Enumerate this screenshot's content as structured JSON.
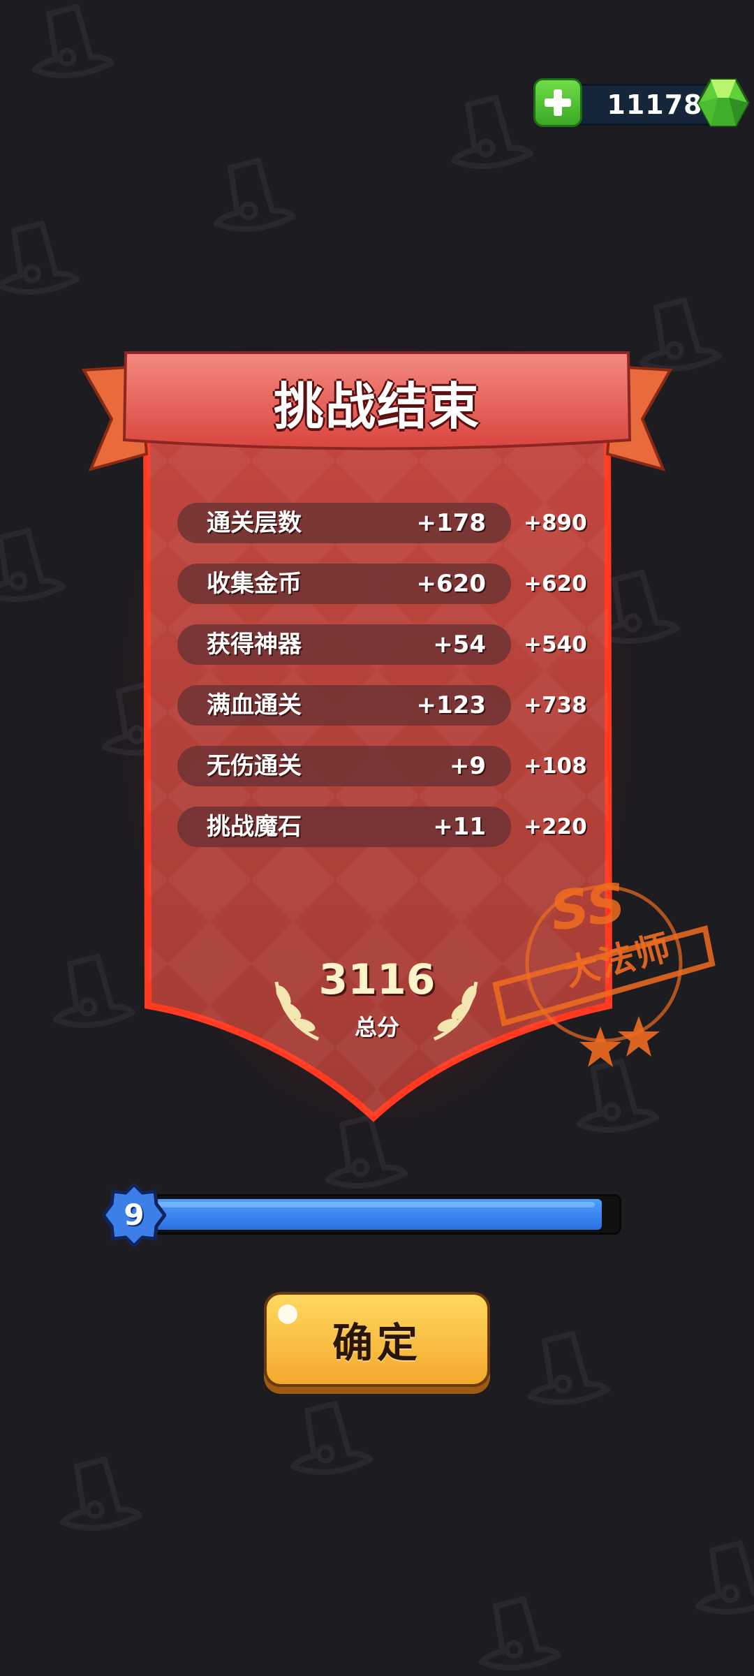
{
  "currency": {
    "amount": "11178",
    "add_icon": "plus-icon",
    "gem_icon": "gem-icon"
  },
  "panel": {
    "title": "挑战结束",
    "rows": [
      {
        "label": "通关层数",
        "count": "+178",
        "bonus": "+890"
      },
      {
        "label": "收集金币",
        "count": "+620",
        "bonus": "+620"
      },
      {
        "label": "获得神器",
        "count": "+54",
        "bonus": "+540"
      },
      {
        "label": "满血通关",
        "count": "+123",
        "bonus": "+738"
      },
      {
        "label": "无伤通关",
        "count": "+9",
        "bonus": "+108"
      },
      {
        "label": "挑战魔石",
        "count": "+11",
        "bonus": "+220"
      }
    ],
    "total_score": "3116",
    "total_label": "总分"
  },
  "rank_stamp": {
    "grade": "SS",
    "title": "大法师"
  },
  "level": {
    "number": "9",
    "progress": 0.97
  },
  "confirm_button": {
    "label": "确定"
  },
  "colors": {
    "background": "#1d1c21",
    "banner": "#e05a52",
    "panel": "#b8473f",
    "xp_fill": "#3f8cf5",
    "button": "#f7c145",
    "stamp": "#f06c1f"
  }
}
